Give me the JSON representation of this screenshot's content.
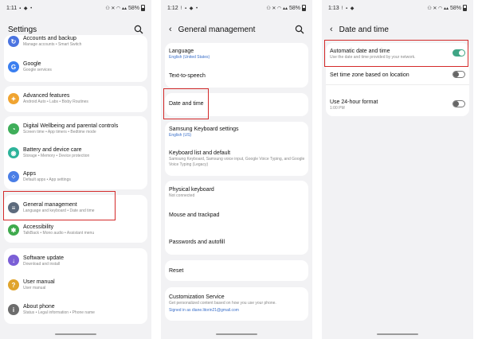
{
  "status_bars": [
    {
      "time": "1:11",
      "battery": "58%"
    },
    {
      "time": "1:12",
      "battery": "58%"
    },
    {
      "time": "1:13",
      "battery": "58%"
    }
  ],
  "panel1": {
    "title": "Settings",
    "items": [
      {
        "title": "Accounts and backup",
        "subtitle": "Manage accounts • Smart Switch",
        "icon": "accounts-icon",
        "color": "#4b74e0"
      },
      {
        "title": "Google",
        "subtitle": "Google services",
        "icon": "google-icon",
        "color": "#3b7ff0"
      },
      {
        "title": "Advanced features",
        "subtitle": "Android Auto • Labs • Bixby Routines",
        "icon": "advanced-features-icon",
        "color": "#f0a431"
      },
      {
        "title": "Digital Wellbeing and parental controls",
        "subtitle": "Screen time • App timers • Bedtime mode",
        "icon": "wellbeing-icon",
        "color": "#3fae5a"
      },
      {
        "title": "Battery and device care",
        "subtitle": "Storage • Memory • Device protection",
        "icon": "battery-care-icon",
        "color": "#2db39a"
      },
      {
        "title": "Apps",
        "subtitle": "Default apps • App settings",
        "icon": "apps-icon",
        "color": "#4a7ee6"
      },
      {
        "title": "General management",
        "subtitle": "Language and keyboard • Date and time",
        "icon": "general-management-icon",
        "color": "#5d6b7d"
      },
      {
        "title": "Accessibility",
        "subtitle": "TalkBack • Mono audio • Assistant menu",
        "icon": "accessibility-icon",
        "color": "#3faa4d"
      },
      {
        "title": "Software update",
        "subtitle": "Download and install",
        "icon": "software-update-icon",
        "color": "#7b5fd6"
      },
      {
        "title": "User manual",
        "subtitle": "User manual",
        "icon": "user-manual-icon",
        "color": "#e0a42c"
      },
      {
        "title": "About phone",
        "subtitle": "Status • Legal information • Phone name",
        "icon": "about-phone-icon",
        "color": "#6d6d6d"
      }
    ]
  },
  "panel2": {
    "title": "General management",
    "items": [
      {
        "title": "Language",
        "subtitle": "English (United States)"
      },
      {
        "title": "Text-to-speech",
        "subtitle": ""
      },
      {
        "title": "Date and time",
        "subtitle": ""
      },
      {
        "title": "Samsung Keyboard settings",
        "subtitle": "English (US)"
      },
      {
        "title": "Keyboard list and default",
        "subtitle": "Samsung Keyboard, Samsung voice input, Google Voice Typing, and Google Voice Typing (Legacy)"
      },
      {
        "title": "Physical keyboard",
        "subtitle": "Not connected"
      },
      {
        "title": "Mouse and trackpad",
        "subtitle": ""
      },
      {
        "title": "Passwords and autofill",
        "subtitle": ""
      },
      {
        "title": "Reset",
        "subtitle": ""
      },
      {
        "title": "Customization Service",
        "subtitle": "Get personalized content based on how you use your phone.",
        "subtitle2": "Signed in as diane.litorin21@gmail.com"
      }
    ]
  },
  "panel3": {
    "title": "Date and time",
    "items": [
      {
        "title": "Automatic date and time",
        "subtitle": "Use the date and time provided by your network.",
        "toggle": "on"
      },
      {
        "title": "Set time zone based on location",
        "subtitle": "",
        "toggle": "off"
      },
      {
        "title": "Use 24-hour format",
        "subtitle": "1:00 PM",
        "toggle": "off"
      }
    ]
  },
  "colors": {
    "highlight": "#d42a2a",
    "toggle_on": "#3fa585",
    "link_blue": "#3a6fc9"
  }
}
